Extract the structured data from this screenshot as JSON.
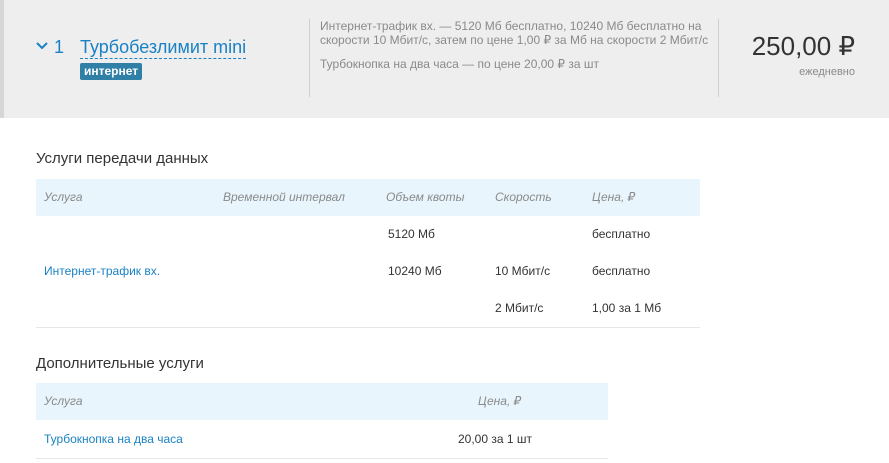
{
  "header": {
    "index": "1",
    "tariff_name": "Турбобезлимит mini",
    "badge": "интернет",
    "desc_line1": "Интернет-трафик вх. — 5120 Мб бесплатно, 10240 Мб бесплатно на скорости 10 Мбит/с, затем по цене 1,00 ₽ за Мб на скорости 2 Мбит/с",
    "desc_line2": "Турбокнопка на два часа — по цене 20,00 ₽ за шт",
    "price": "250,00 ₽",
    "period": "ежедневно"
  },
  "data_services": {
    "title": "Услуги передачи данных",
    "columns": [
      "Услуга",
      "Временной интервал",
      "Объем квоты",
      "Скорость",
      "Цена, ₽"
    ],
    "service_name": "Интернет-трафик вх.",
    "rows": [
      {
        "quota": "5120 Мб",
        "speed": "",
        "price": "бесплатно"
      },
      {
        "quota": "10240 Мб",
        "speed": "10 Мбит/с",
        "price": "бесплатно"
      },
      {
        "quota": "",
        "speed": "2 Мбит/с",
        "price": "1,00 за 1 Мб"
      }
    ]
  },
  "extra_services": {
    "title": "Дополнительные услуги",
    "columns": [
      "Услуга",
      "Цена, ₽"
    ],
    "rows": [
      {
        "name": "Турбокнопка на два часа",
        "price": "20,00 за 1 шт"
      }
    ]
  },
  "colors": {
    "accent": "#1a82c4",
    "badge_bg": "#2f7fa7",
    "header_bg": "#eeeeee",
    "table_head_bg": "#e8f5fd"
  }
}
